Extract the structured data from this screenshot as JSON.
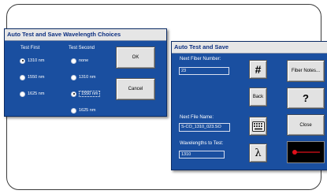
{
  "choices_dialog": {
    "title": "Auto Test and Save Wavelength Choices",
    "test_first_label": "Test First",
    "test_second_label": "Test Second",
    "test_first_options": [
      "1310 nm",
      "1550 nm",
      "1625 nm"
    ],
    "test_first_selected": "1310 nm",
    "test_second_options": [
      "none",
      "1310 nm",
      "1550 nm",
      "1625 nm"
    ],
    "test_second_selected": "1550 nm",
    "ok_label": "OK",
    "cancel_label": "Cancel"
  },
  "save_dialog": {
    "title": "Auto Test and Save",
    "next_fiber_label": "Next Fiber Number:",
    "next_fiber_value": "23",
    "next_file_label": "Next File Name:",
    "next_file_value": "S-CO_1310_023.SO",
    "wavelengths_label": "Wavelengths to Test:",
    "wavelengths_value": "1310",
    "hash_label": "#",
    "back_label": "Back",
    "lambda_label": "λ",
    "fiber_notes_label": "Fiber Notes...",
    "help_label": "?",
    "close_label": "Close",
    "icons": {
      "keyboard": "keyboard-icon",
      "laser": "laser-icon"
    },
    "colors": {
      "laser_button_bg": "#000000",
      "laser_beam": "#e0101a"
    }
  }
}
